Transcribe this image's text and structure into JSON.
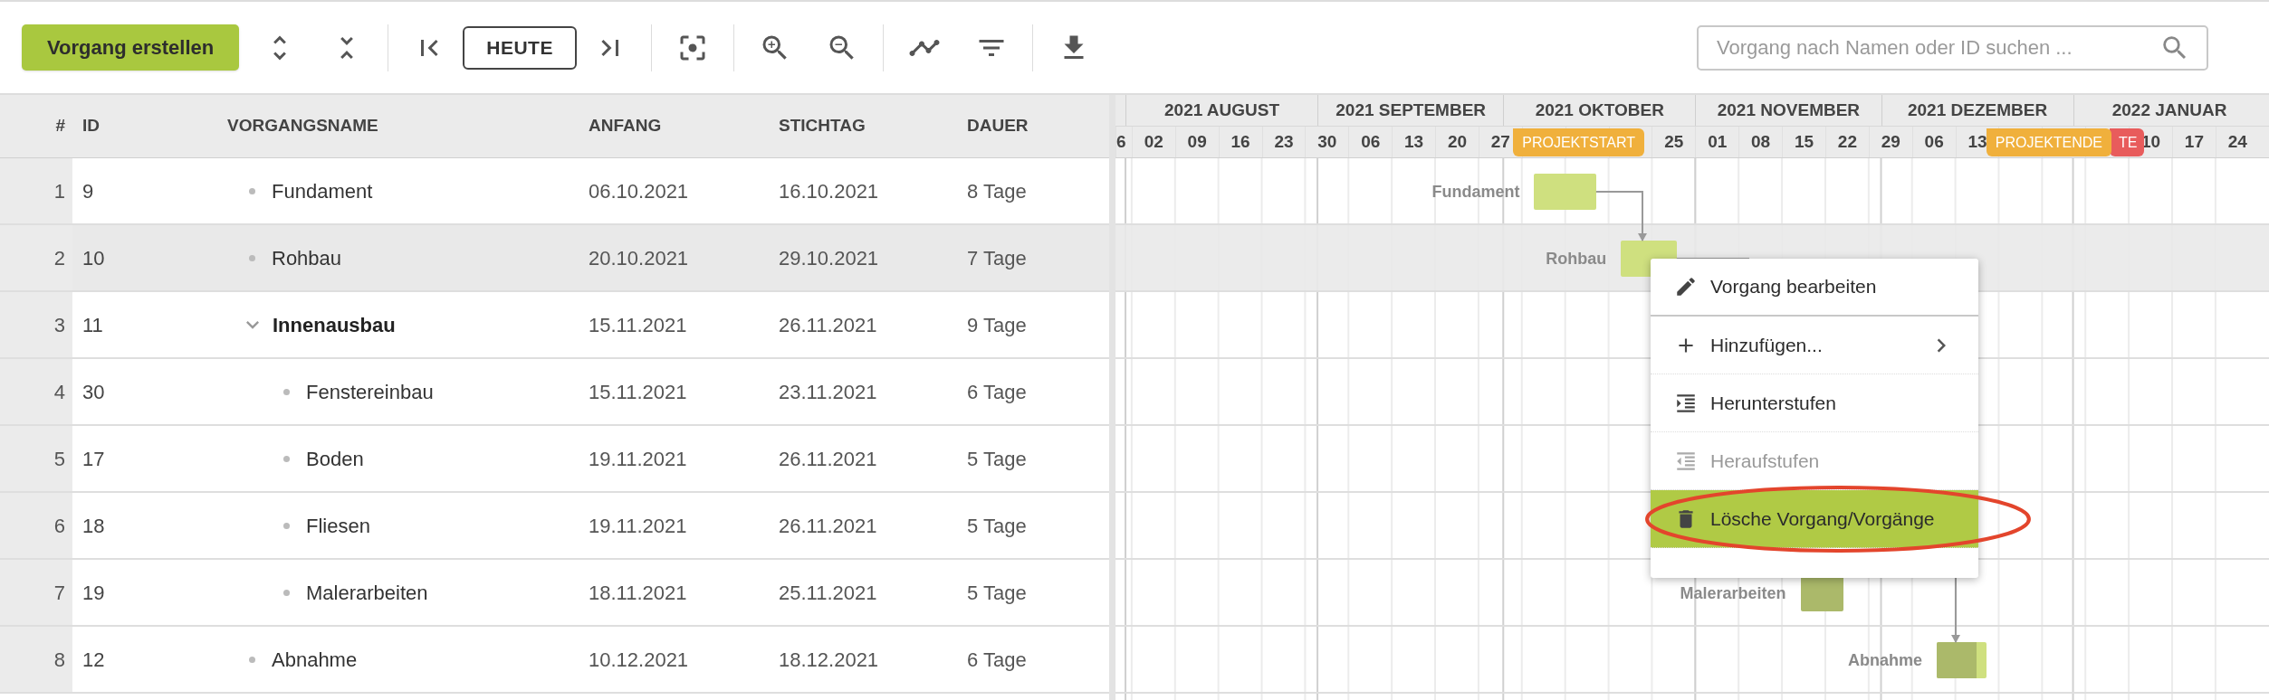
{
  "toolbar": {
    "create_button": "Vorgang erstellen",
    "today_button": "HEUTE",
    "search": {
      "placeholder": "Vorgang nach Namen oder ID suchen ..."
    }
  },
  "table": {
    "columns": [
      "#",
      "ID",
      "VORGANGSNAME",
      "ANFANG",
      "STICHTAG",
      "DAUER"
    ],
    "rows": [
      {
        "num": "1",
        "id": "9",
        "name": "Fundament",
        "start": "06.10.2021",
        "end": "16.10.2021",
        "duration": "8 Tage",
        "selected": false
      },
      {
        "num": "2",
        "id": "10",
        "name": "Rohbau",
        "start": "20.10.2021",
        "end": "29.10.2021",
        "duration": "7 Tage",
        "selected": true
      },
      {
        "num": "3",
        "id": "11",
        "name": "Innenausbau",
        "start": "15.11.2021",
        "end": "26.11.2021",
        "duration": "9 Tage",
        "selected": false,
        "expanded": true,
        "children": [
          {
            "num": "4",
            "id": "30",
            "name": "Fenstereinbau",
            "start": "15.11.2021",
            "end": "23.11.2021",
            "duration": "6 Tage",
            "selected": false
          },
          {
            "num": "5",
            "id": "17",
            "name": "Boden",
            "start": "19.11.2021",
            "end": "26.11.2021",
            "duration": "5 Tage",
            "selected": false
          },
          {
            "num": "6",
            "id": "18",
            "name": "Fliesen",
            "start": "19.11.2021",
            "end": "26.11.2021",
            "duration": "5 Tage",
            "selected": false
          },
          {
            "num": "7",
            "id": "19",
            "name": "Malerarbeiten",
            "start": "18.11.2021",
            "end": "25.11.2021",
            "duration": "5 Tage",
            "selected": false
          }
        ]
      },
      {
        "num": "8",
        "id": "12",
        "name": "Abnahme",
        "start": "10.12.2021",
        "end": "18.12.2021",
        "duration": "6 Tage",
        "selected": false
      }
    ]
  },
  "gantt": {
    "months": [
      "2021 AUGUST",
      "2021 SEPTEMBER",
      "2021 OKTOBER",
      "2021 NOVEMBER",
      "2021 DEZEMBER",
      "2022 JANUAR"
    ],
    "week_groups": [
      [
        "6",
        "02",
        "09",
        "16",
        "23",
        "30",
        "06",
        "13",
        "20",
        "27"
      ],
      [
        "25",
        "01",
        "08",
        "15",
        "22",
        "29",
        "06",
        "13"
      ],
      [
        "10",
        "17",
        "24"
      ]
    ],
    "markers": [
      {
        "label": "PROJEKTSTART",
        "color": "#f0b03c"
      },
      {
        "label": "PROJEKTENDE",
        "color": "#f0b03c"
      },
      {
        "label": "TE",
        "color": "#e85c5c"
      }
    ],
    "rows": [
      {
        "selected": false,
        "bar": {
          "label": "Fundament",
          "level": 0
        }
      },
      {
        "selected": true,
        "bar": {
          "label": "Rohbau",
          "level": 0
        }
      },
      {
        "selected": false
      },
      {
        "selected": false
      },
      {
        "selected": false
      },
      {
        "selected": false
      },
      {
        "selected": false,
        "bar": {
          "label": "Malerarbeiten",
          "level": 1
        }
      },
      {
        "selected": false,
        "bar": {
          "label": "Abnahme",
          "level": 0.8
        }
      }
    ]
  },
  "context_menu": {
    "items": [
      {
        "label": "Vorgang bearbeiten",
        "kind": "edit",
        "disabled": false,
        "selected": false
      },
      {
        "label": "Hinzufügen...",
        "kind": "add",
        "disabled": false,
        "selected": false,
        "submenu": true
      },
      {
        "label": "Herunterstufen",
        "kind": "indent",
        "disabled": false,
        "selected": false
      },
      {
        "label": "Heraufstufen",
        "kind": "outdent",
        "disabled": true,
        "selected": false
      },
      {
        "label": "Lösche Vorgang/Vorgänge",
        "kind": "delete",
        "disabled": false,
        "selected": true
      }
    ]
  }
}
